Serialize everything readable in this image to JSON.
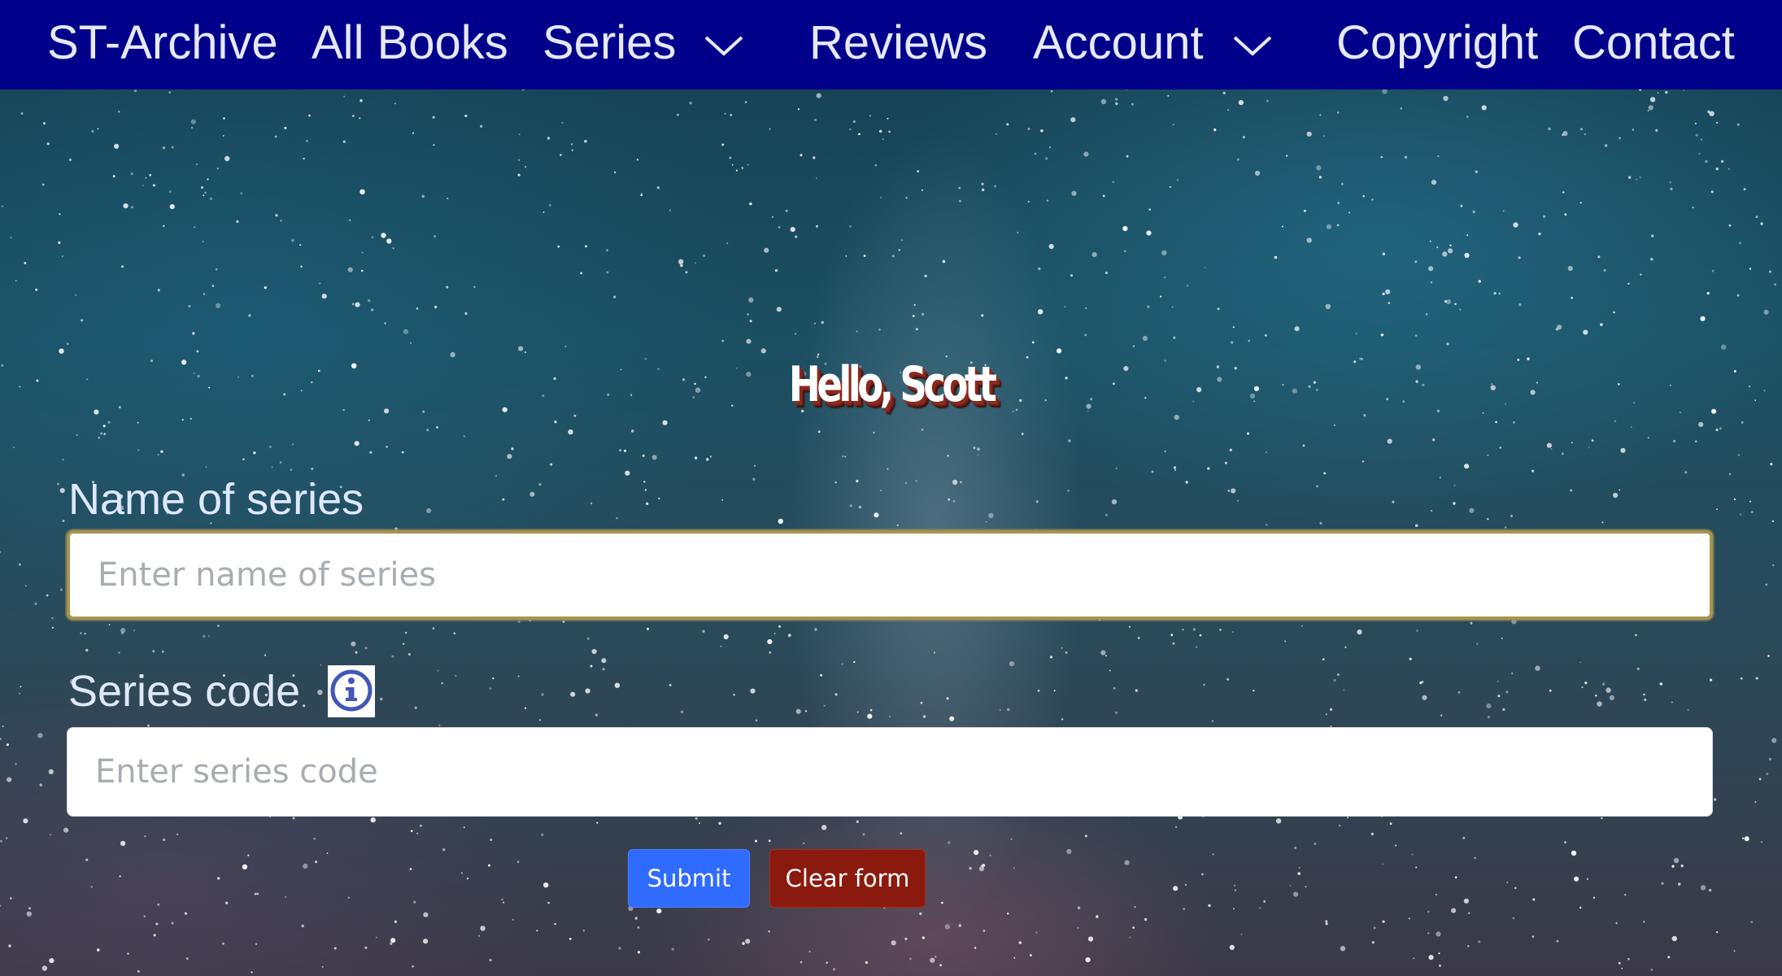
{
  "navbar": {
    "brand": "ST-Archive",
    "items": [
      {
        "label": "All Books"
      },
      {
        "label": "Series"
      },
      {
        "label": "Reviews"
      },
      {
        "label": "Account"
      },
      {
        "label": "Copyright"
      },
      {
        "label": "Contact"
      }
    ],
    "background_color": "#00008b"
  },
  "greeting": "Hello, Scott",
  "form": {
    "name_label": "Name of series",
    "name_placeholder": "Enter name of series",
    "name_value": "",
    "code_label": "Series code",
    "code_placeholder": "Enter series code",
    "code_value": "",
    "info_icon": "info-circle-icon",
    "submit_label": "Submit",
    "clear_label": "Clear form"
  },
  "colors": {
    "submit": "#2f6bff",
    "clear": "#8b1a0e",
    "focus_border": "#a8944f"
  }
}
